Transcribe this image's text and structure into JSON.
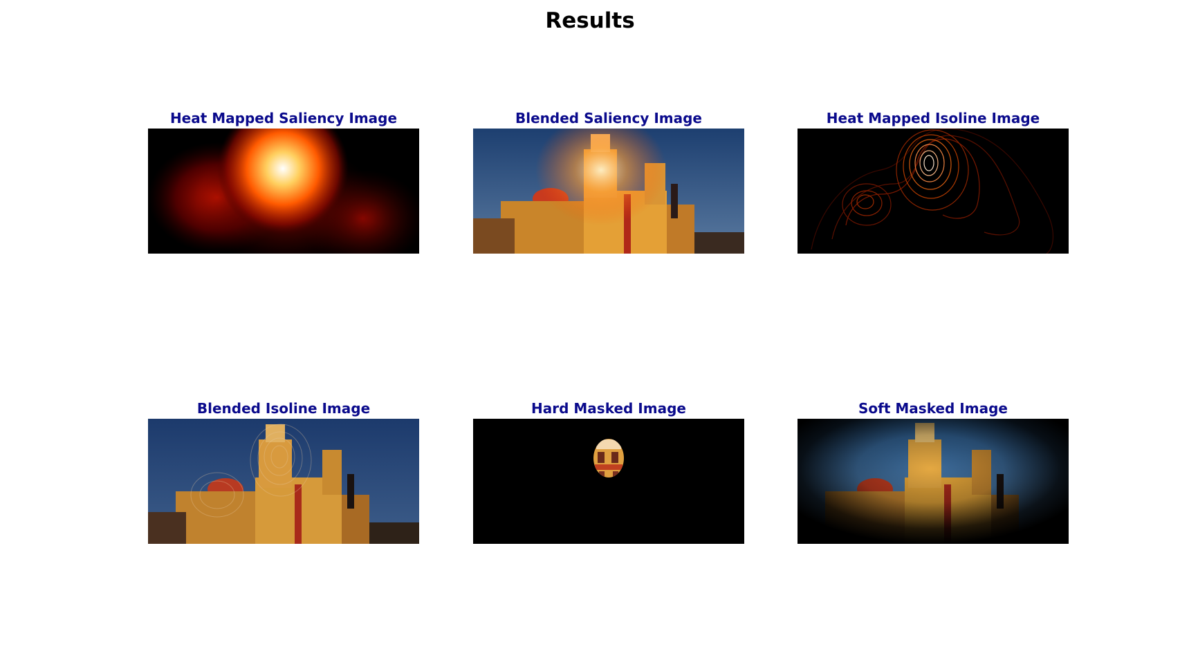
{
  "figure": {
    "title": "Results"
  },
  "panels": [
    {
      "title": "Heat Mapped Saliency Image"
    },
    {
      "title": "Blended Saliency Image"
    },
    {
      "title": "Heat Mapped Isoline Image"
    },
    {
      "title": "Blended Isoline Image"
    },
    {
      "title": "Hard Masked Image"
    },
    {
      "title": "Soft Masked Image"
    }
  ],
  "colors": {
    "panel_title": "#0a0a8c",
    "sky": "#1f3e6e",
    "facade": "#e0a030",
    "heat_core": "#ffffff",
    "heat_mid": "#ff6a00",
    "heat_outer": "#8b0000"
  }
}
